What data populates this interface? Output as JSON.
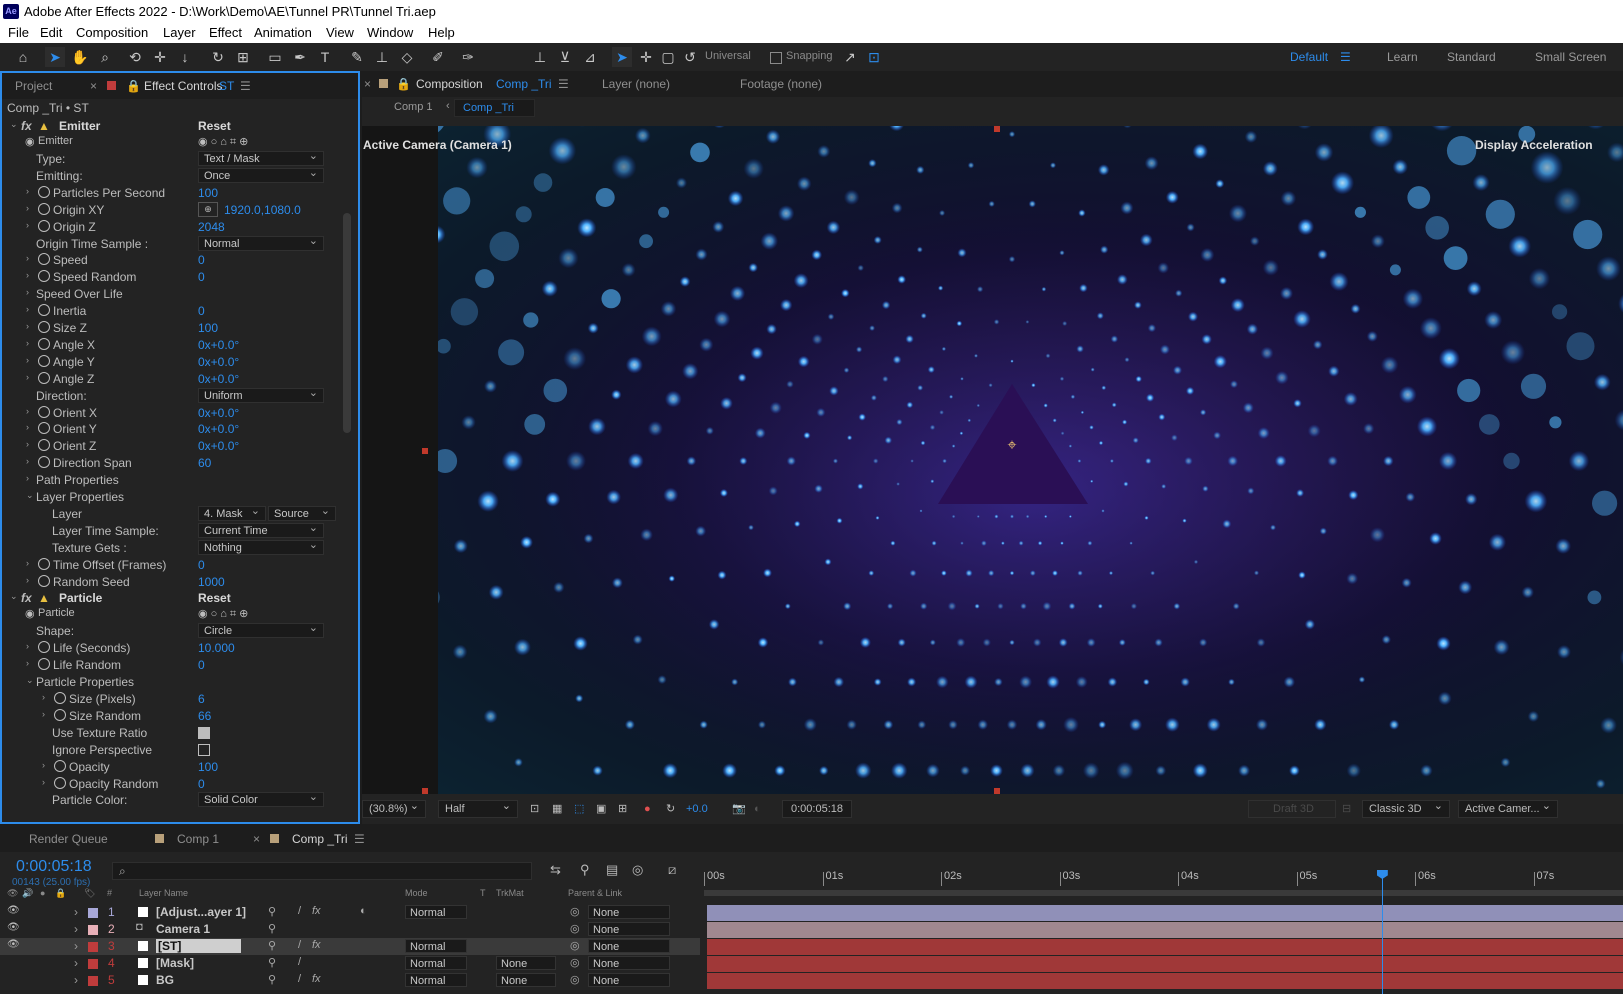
{
  "app": {
    "logo": "Ae",
    "title": "Adobe After Effects 2022 - D:\\Work\\Demo\\AE\\Tunnel PR\\Tunnel Tri.aep"
  },
  "menu": [
    "File",
    "Edit",
    "Composition",
    "Layer",
    "Effect",
    "Animation",
    "View",
    "Window",
    "Help"
  ],
  "toolbar": {
    "universal_label": "Universal",
    "snapping_label": "Snapping",
    "workspaces": [
      "Default",
      "Learn",
      "Standard",
      "Small Screen"
    ],
    "active_workspace": "Default"
  },
  "left_panel": {
    "tabs": [
      "Project",
      "Effect Controls",
      "ST"
    ],
    "breadcrumb": "Comp _Tri • ST"
  },
  "effect_controls": {
    "emitter": {
      "title": "Emitter",
      "reset": "Reset",
      "sub": "Emitter",
      "rows": [
        {
          "label": "Type:",
          "dd": "Text / Mask"
        },
        {
          "label": "Emitting:",
          "dd": "Once"
        },
        {
          "label": "Particles Per Second",
          "val": "100"
        },
        {
          "label": "Origin XY",
          "val": "1920.0,1080.0"
        },
        {
          "label": "Origin Z",
          "val": "2048"
        },
        {
          "label": "Origin Time Sample :",
          "dd": "Normal"
        },
        {
          "label": "Speed",
          "val": "0"
        },
        {
          "label": "Speed Random",
          "val": "0"
        },
        {
          "label": "Speed Over Life"
        },
        {
          "label": "Inertia",
          "val": "0"
        },
        {
          "label": "Size Z",
          "val": "100"
        },
        {
          "label": "Angle X",
          "val": "0x+0.0°"
        },
        {
          "label": "Angle Y",
          "val": "0x+0.0°"
        },
        {
          "label": "Angle Z",
          "val": "0x+0.0°"
        },
        {
          "label": "Direction:",
          "dd": "Uniform"
        },
        {
          "label": "Orient X",
          "val": "0x+0.0°"
        },
        {
          "label": "Orient Y",
          "val": "0x+0.0°"
        },
        {
          "label": "Orient Z",
          "val": "0x+0.0°"
        },
        {
          "label": "Direction Span",
          "val": "60"
        },
        {
          "label": "Path Properties"
        },
        {
          "label": "Layer Properties"
        },
        {
          "label": "Layer",
          "dd": "4. Mask",
          "dd2": "Source"
        },
        {
          "label": "Layer Time Sample:",
          "dd": "Current Time"
        },
        {
          "label": "Texture Gets :",
          "dd": "Nothing"
        },
        {
          "label": "Time Offset (Frames)",
          "val": "0"
        },
        {
          "label": "Random Seed",
          "val": "1000"
        }
      ]
    },
    "particle": {
      "title": "Particle",
      "reset": "Reset",
      "sub": "Particle",
      "rows": [
        {
          "label": "Shape:",
          "dd": "Circle"
        },
        {
          "label": "Life (Seconds)",
          "val": "10.000"
        },
        {
          "label": "Life Random",
          "val": "0"
        },
        {
          "label": "Particle Properties"
        },
        {
          "label": "Size (Pixels)",
          "val": "6"
        },
        {
          "label": "Size Random",
          "val": "66"
        },
        {
          "label": "Use Texture Ratio",
          "checked": true
        },
        {
          "label": "Ignore Perspective",
          "checked": false
        },
        {
          "label": "Opacity",
          "val": "100"
        },
        {
          "label": "Opacity Random",
          "val": "0"
        },
        {
          "label": "Particle Color:",
          "dd": "Solid Color"
        }
      ]
    }
  },
  "comp_panel": {
    "tab_prefix": "Composition",
    "tab_name": "Comp _Tri",
    "layer_tab": "Layer (none)",
    "footage_tab": "Footage (none)",
    "crumbs": [
      "Comp 1",
      "Comp _Tri"
    ],
    "camera_label": "Active Camera (Camera 1)",
    "display_accel": "Display Acceleration",
    "bottom": {
      "zoom": "(30.8%)",
      "resolution": "Half",
      "exposure": "+0.0",
      "timecode": "0:00:05:18",
      "draft3d": "Draft 3D",
      "renderer": "Classic 3D",
      "view": "Active Camer..."
    }
  },
  "timeline": {
    "tabs": [
      "Render Queue",
      "Comp 1",
      "Comp _Tri"
    ],
    "timecode": "0:00:05:18",
    "frames": "00143 (25.00 fps)",
    "col_layer": "Layer Name",
    "col_mode": "Mode",
    "col_t": "T",
    "col_trkmat": "TrkMat",
    "col_parent": "Parent & Link",
    "ruler": [
      "00s",
      "01s",
      "02s",
      "03s",
      "04s",
      "05s",
      "06s",
      "07s"
    ],
    "playhead_seconds": 5.72,
    "layers": [
      {
        "num": "1",
        "name": "[Adjust...ayer 1]",
        "mode": "Normal",
        "trkmat": "",
        "parent": "None",
        "color": "#a8a8d8",
        "bar": "#9090b8"
      },
      {
        "num": "2",
        "name": "Camera 1",
        "mode": "",
        "trkmat": "",
        "parent": "None",
        "color": "#e8b0b8",
        "bar": "#a08890"
      },
      {
        "num": "3",
        "name": "[ST]",
        "mode": "Normal",
        "trkmat": "",
        "parent": "None",
        "color": "#c03c3c",
        "bar": "#a03838"
      },
      {
        "num": "4",
        "name": "[Mask]",
        "mode": "Normal",
        "trkmat": "None",
        "parent": "None",
        "color": "#c03c3c",
        "bar": "#a03838"
      },
      {
        "num": "5",
        "name": "BG",
        "mode": "Normal",
        "trkmat": "None",
        "parent": "None",
        "color": "#c03c3c",
        "bar": "#a03838"
      }
    ]
  }
}
